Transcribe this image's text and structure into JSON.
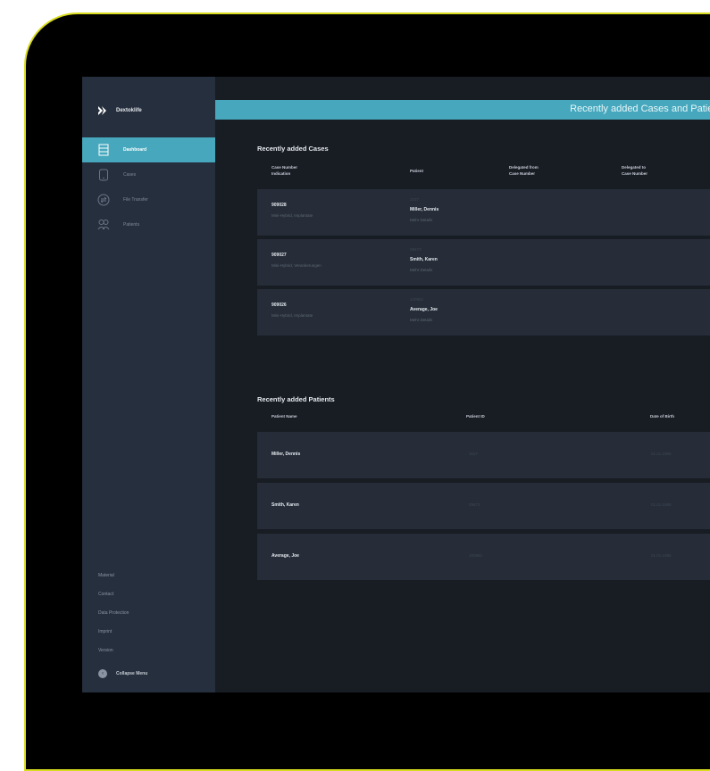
{
  "app": {
    "name": "Dextoklife"
  },
  "sidebar": {
    "items": [
      {
        "label": "Dashboard",
        "icon": "dashboard-icon",
        "active": true
      },
      {
        "label": "Cases",
        "icon": "case-icon",
        "active": false
      },
      {
        "label": "File Transfer",
        "icon": "transfer-icon",
        "active": false
      },
      {
        "label": "Patients",
        "icon": "patients-icon",
        "active": false
      }
    ],
    "footer_links": [
      "Material",
      "Contact",
      "Data Protection",
      "Imprint",
      "Version"
    ],
    "collapse_label": "Collapse Menu"
  },
  "header": {
    "title": "Recently added Cases and Patients"
  },
  "cases": {
    "title": "Recently added Cases",
    "columns": {
      "case": [
        "Case Number",
        "Indication"
      ],
      "patient": "Patient",
      "delegated_from": [
        "Delegated from",
        "Case Number"
      ],
      "delegated_to": [
        "Delegated to",
        "Case Number"
      ]
    },
    "rows": [
      {
        "case_number": "909028",
        "indication": "Mini-Hybrid, Implantate",
        "patient_id": "1027",
        "patient_name": "Miller, Dennis",
        "patient_extra": "Mehr Details"
      },
      {
        "case_number": "909027",
        "indication": "Mini-Hybrid, Verankerungen",
        "patient_id": "09673",
        "patient_name": "Smith, Karen",
        "patient_extra": "Mehr Details"
      },
      {
        "case_number": "909026",
        "indication": "Mini-Hybrid, Implantate",
        "patient_id": "100982",
        "patient_name": "Average, Joe",
        "patient_extra": "Mehr Details"
      }
    ]
  },
  "patients": {
    "title": "Recently added Patients",
    "columns": {
      "name": "Patient Name",
      "id": "Patient ID",
      "dob": "Date of Birth"
    },
    "rows": [
      {
        "name": "Miller, Dennis",
        "id": "1027",
        "dob": "01.01.1985"
      },
      {
        "name": "Smith, Karen",
        "id": "09673",
        "dob": "01.01.1985"
      },
      {
        "name": "Average, Joe",
        "id": "100982",
        "dob": "01.01.1985"
      }
    ]
  },
  "colors": {
    "accent": "#47a8bd",
    "sidebar": "#262f3d",
    "background": "#181c23",
    "bezel_outline": "#d8dc1e"
  }
}
